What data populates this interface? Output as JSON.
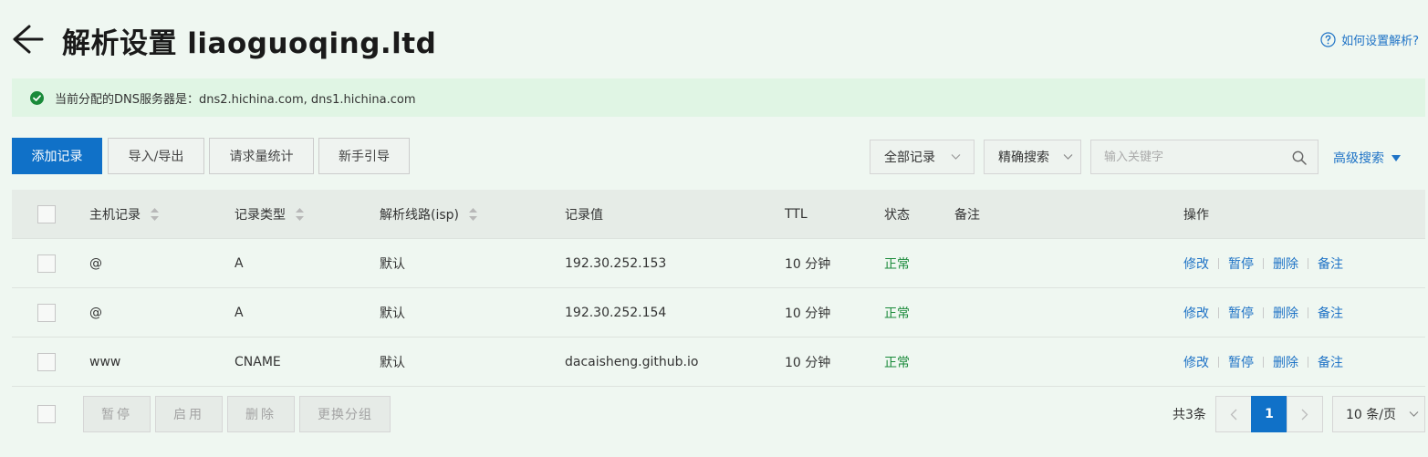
{
  "header": {
    "title": "解析设置 liaoguoqing.ltd",
    "help_link": "如何设置解析?"
  },
  "notice": {
    "text": "当前分配的DNS服务器是：dns2.hichina.com, dns1.hichina.com"
  },
  "toolbar": {
    "add_record": "添加记录",
    "import_export": "导入/导出",
    "request_stats": "请求量统计",
    "beginner_guide": "新手引导",
    "record_filter": "全部记录",
    "search_mode": "精确搜索",
    "search_placeholder": "输入关键字",
    "advanced_search": "高级搜索"
  },
  "table": {
    "columns": {
      "host": "主机记录",
      "type": "记录类型",
      "line": "解析线路(isp)",
      "value": "记录值",
      "ttl": "TTL",
      "status": "状态",
      "remark": "备注",
      "actions": "操作"
    },
    "rows": [
      {
        "host": "@",
        "type": "A",
        "line": "默认",
        "value": "192.30.252.153",
        "ttl": "10 分钟",
        "status": "正常",
        "remark": ""
      },
      {
        "host": "@",
        "type": "A",
        "line": "默认",
        "value": "192.30.252.154",
        "ttl": "10 分钟",
        "status": "正常",
        "remark": ""
      },
      {
        "host": "www",
        "type": "CNAME",
        "line": "默认",
        "value": "dacaisheng.github.io",
        "ttl": "10 分钟",
        "status": "正常",
        "remark": ""
      }
    ],
    "row_actions": {
      "edit": "修改",
      "pause": "暂停",
      "delete": "删除",
      "remark": "备注"
    }
  },
  "footer": {
    "bulk_pause": "暂停",
    "bulk_enable": "启用",
    "bulk_delete": "删除",
    "bulk_change_group": "更换分组",
    "total": "共3条",
    "current_page": "1",
    "page_size": "10 条/页"
  },
  "colors": {
    "primary": "#1071c8",
    "link": "#1f73c6",
    "status_ok": "#1a8a3a",
    "notice_bg": "#e0f5e4",
    "page_bg": "#eff7f1"
  },
  "icons": {
    "back": "back-arrow-icon",
    "help": "question-circle-icon",
    "notice": "check-circle-icon",
    "search": "search-icon",
    "sort": "sort-icon",
    "dropdown": "chevron-down-icon"
  }
}
